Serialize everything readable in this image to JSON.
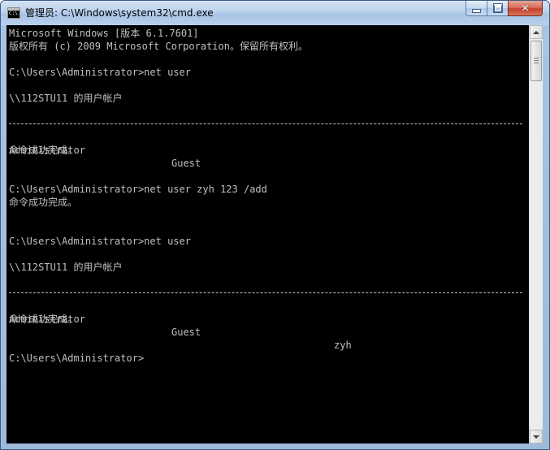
{
  "window": {
    "title": "管理员: C:\\Windows\\system32\\cmd.exe",
    "icon_label": "C:\\."
  },
  "console": {
    "lines": [
      "Microsoft Windows [版本 6.1.7601]",
      "版权所有 (c) 2009 Microsoft Corporation。保留所有权利。",
      "C:\\Users\\Administrator>net user",
      "\\\\112STU11 的用户帐户",
      "命令成功完成。",
      "C:\\Users\\Administrator>net user zyh 123 /add",
      "命令成功完成。",
      "C:\\Users\\Administrator>net user",
      "\\\\112STU11 的用户帐户",
      "命令成功完成。",
      "C:\\Users\\Administrator>"
    ],
    "user_list_1": [
      "Administrator",
      "Guest"
    ],
    "user_list_2": [
      "Administrator",
      "Guest",
      "zyh"
    ]
  },
  "colors": {
    "console_bg": "#000000",
    "console_fg": "#c0c0c0"
  }
}
